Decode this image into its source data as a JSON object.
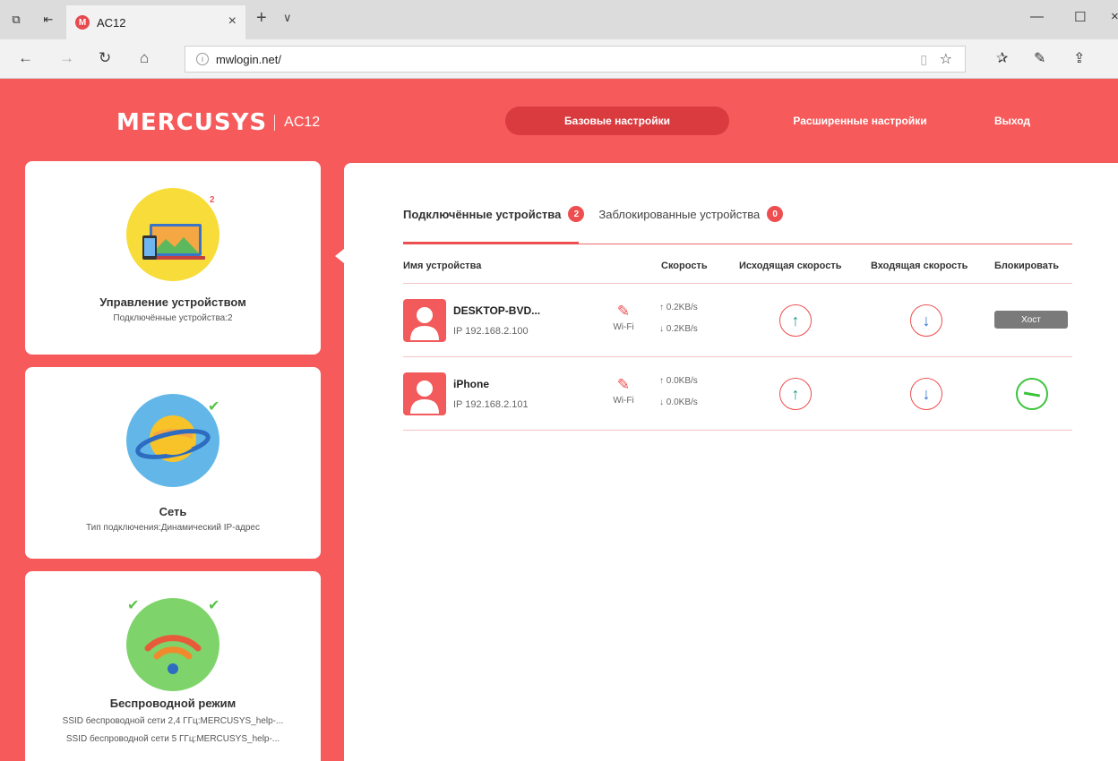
{
  "browser": {
    "tab_title": "AC12",
    "favicon_letter": "M",
    "url": "mwlogin.net/"
  },
  "router": {
    "brand": "MERCUSYS",
    "model": "AC12",
    "nav": {
      "basic": "Базовые настройки",
      "advanced": "Расширенные настройки",
      "logout": "Выход"
    },
    "cards": {
      "device_mgmt": {
        "title": "Управление устройством",
        "subtitle": "Подключённые устройства:2",
        "badge": "2"
      },
      "network": {
        "title": "Сеть",
        "subtitle": "Тип подключения:Динамический IP-адрес"
      },
      "wireless": {
        "title": "Беспроводной режим",
        "ssid_24": "SSID беспроводной сети 2,4 ГГц:MERCUSYS_help-...",
        "ssid_5": "SSID беспроводной сети 5 ГГц:MERCUSYS_help-..."
      }
    },
    "tabs": {
      "connected_label": "Подключённые устройства",
      "connected_count": "2",
      "blocked_label": "Заблокированные устройства",
      "blocked_count": "0"
    },
    "table": {
      "headers": {
        "name": "Имя устройства",
        "speed": "Скорость",
        "upload": "Исходящая скорость",
        "download": "Входящая скорость",
        "block": "Блокировать"
      },
      "rows": [
        {
          "name": "DESKTOP-BVD...",
          "ip": "IP 192.168.2.100",
          "conn": "Wi-Fi",
          "up": "↑ 0.2KB/s",
          "down": "↓ 0.2KB/s",
          "block_label": "Хост"
        },
        {
          "name": "iPhone",
          "ip": "IP 192.168.2.101",
          "conn": "Wi-Fi",
          "up": "↑ 0.0KB/s",
          "down": "↓ 0.0KB/s"
        }
      ]
    }
  },
  "colors": {
    "accent": "#f65a5b",
    "upload_arrow": "#1a9c8c",
    "download_arrow": "#2a6fd6",
    "unblock_green": "#3cc43c"
  }
}
